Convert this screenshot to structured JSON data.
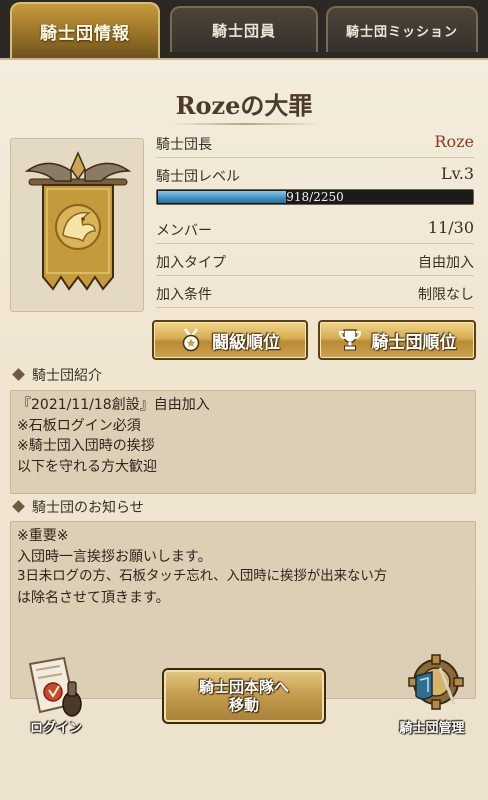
{
  "tabs": [
    {
      "label": "騎士団情報",
      "active": true
    },
    {
      "label": "騎士団員",
      "active": false
    },
    {
      "label": "騎士団ミッション",
      "active": false
    }
  ],
  "guild": {
    "name": "Rozeの大罪",
    "emblem_icon": "griffin-banner-icon",
    "leader_label": "騎士団長",
    "leader_value": "Roze",
    "level_label": "騎士団レベル",
    "level_value": "Lv.3",
    "xp_text": "918/2250",
    "xp_fraction": 0.408,
    "members_label": "メンバー",
    "members_value": "11/30",
    "join_type_label": "加入タイプ",
    "join_type_value": "自由加入",
    "join_cond_label": "加入条件",
    "join_cond_value": "制限なし"
  },
  "buttons": {
    "arena_rank": "闘級順位",
    "guild_rank": "騎士団順位",
    "move_line1": "騎士団本隊へ",
    "move_line2": "移動",
    "login": "ログイン",
    "manage": "騎士団管理"
  },
  "intro": {
    "heading": "騎士団紹介",
    "lines": [
      "『2021/11/18創設』自由加入",
      "※石板ログイン必須",
      "※騎士団入団時の挨拶",
      "以下を守れる方大歓迎"
    ]
  },
  "notice": {
    "heading": "騎士団のお知らせ",
    "lines": [
      "※重要※",
      "入団時一言挨拶お願いします。",
      "3日未ログの方、石板タッチ忘れ、入団時に挨拶が出来ない方",
      "は除名させて頂きます。"
    ]
  },
  "colors": {
    "tab_active": "#c79a3c",
    "panel_bg": "#f0e7d4",
    "xp_fill": "#3f8ec0",
    "leader_name": "#8a3b22"
  }
}
